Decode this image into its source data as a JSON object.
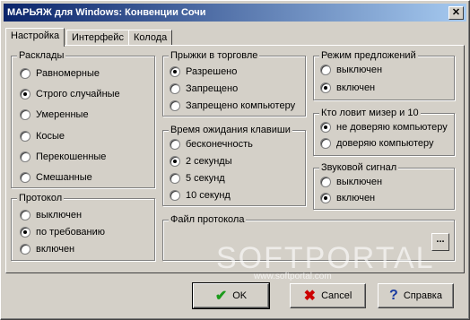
{
  "window": {
    "title": "МАРЬЯЖ для Windows: Конвенции Сочи",
    "close": "✕"
  },
  "tabs": [
    "Настройка",
    "Интерфейс",
    "Колода"
  ],
  "groups": {
    "deals": {
      "title": "Расклады",
      "options": [
        "Равномерные",
        "Строго случайные",
        "Умеренные",
        "Косые",
        "Перекошенные",
        "Смешанные"
      ],
      "selected": 1
    },
    "protocol": {
      "title": "Протокол",
      "options": [
        "выключен",
        "по требованию",
        "включен"
      ],
      "selected": 1
    },
    "trade_jumps": {
      "title": "Прыжки в торговле",
      "options": [
        "Разрешено",
        "Запрещено",
        "Запрещено компьютеру"
      ],
      "selected": 0
    },
    "wait_time": {
      "title": "Время ожидания клавиши",
      "options": [
        "бесконечность",
        "2 секунды",
        "5 секунд",
        "10 секунд"
      ],
      "selected": 1
    },
    "log_file": {
      "title": "Файл протокола",
      "browse": "..."
    },
    "suggestions": {
      "title": "Режим предложений",
      "options": [
        "выключен",
        "включен"
      ],
      "selected": 1
    },
    "misere": {
      "title": "Кто ловит мизер и 10",
      "options": [
        "не доверяю компьютеру",
        "доверяю компьютеру"
      ],
      "selected": 0
    },
    "sound": {
      "title": "Звуковой сигнал",
      "options": [
        "выключен",
        "включен"
      ],
      "selected": 1
    }
  },
  "buttons": {
    "ok": "OK",
    "cancel": "Cancel",
    "help": "Справка"
  },
  "watermark": {
    "main": "SOFTPORTAL",
    "sub": "www.softportal.com"
  },
  "colors": {
    "title_start": "#0a246a",
    "title_end": "#a6caf0",
    "ok_check": "#1a9a1a",
    "cancel_x": "#cc0000",
    "help_q": "#1a3aa0"
  }
}
